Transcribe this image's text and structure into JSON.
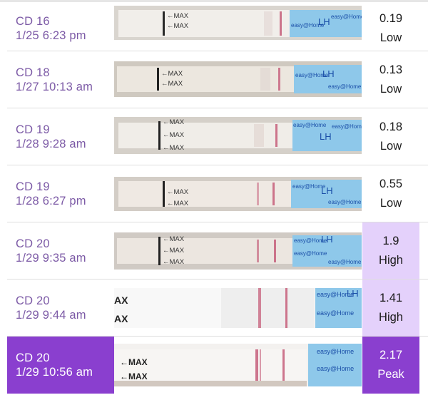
{
  "strip_labels": {
    "max": "←MAX",
    "max_plain": "MAX",
    "max_short": "AX",
    "brand": "easy@Home",
    "lh": "LH"
  },
  "colors": {
    "accent": "#8a3fcf",
    "high_bg": "#e4d1fb",
    "label_text": "#7c5aa6",
    "test_line": "#c55e7a",
    "packaging_blue": "#8ec8ea"
  },
  "tests": [
    {
      "cycle_day": "CD 16",
      "datetime": "1/25 6:23 pm",
      "value": "0.19",
      "level": "Low",
      "selected": false,
      "test_line_intensity": 0.35
    },
    {
      "cycle_day": "CD 18",
      "datetime": "1/27 10:13 am",
      "value": "0.13",
      "level": "Low",
      "selected": false,
      "test_line_intensity": 0.2
    },
    {
      "cycle_day": "CD 19",
      "datetime": "1/28 9:28 am",
      "value": "0.18",
      "level": "Low",
      "selected": false,
      "test_line_intensity": 0.3
    },
    {
      "cycle_day": "CD 19",
      "datetime": "1/28 6:27 pm",
      "value": "0.55",
      "level": "Low",
      "selected": false,
      "test_line_intensity": 0.5
    },
    {
      "cycle_day": "CD 20",
      "datetime": "1/29 9:35 am",
      "value": "1.9",
      "level": "High",
      "selected": false,
      "test_line_intensity": 0.65
    },
    {
      "cycle_day": "CD 20",
      "datetime": "1/29 9:44 am",
      "value": "1.41",
      "level": "High",
      "selected": false,
      "test_line_intensity": 0.7
    },
    {
      "cycle_day": "CD 20",
      "datetime": "1/29 10:56 am",
      "value": "2.17",
      "level": "Peak",
      "selected": true,
      "test_line_intensity": 0.9
    }
  ]
}
